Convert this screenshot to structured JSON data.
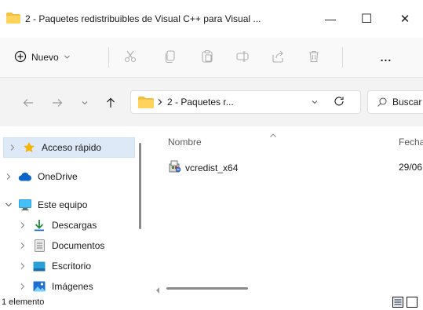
{
  "window": {
    "title": "2 - Paquetes redistribuibles de Visual C++ para Visual ...",
    "minimize": "—",
    "maximize": "☐",
    "close": "✕"
  },
  "toolbar": {
    "new_label": "Nuevo",
    "more": "..."
  },
  "address": {
    "path_label": "2 - Paquetes r...",
    "search_placeholder": "Buscar en"
  },
  "sidebar": {
    "items": [
      {
        "label": "Acceso rápido",
        "icon": "star-icon",
        "selected": true
      },
      {
        "label": "OneDrive",
        "icon": "cloud-icon"
      },
      {
        "label": "Este equipo",
        "icon": "monitor-icon",
        "expanded": true
      },
      {
        "label": "Descargas",
        "icon": "download-icon"
      },
      {
        "label": "Documentos",
        "icon": "document-icon"
      },
      {
        "label": "Escritorio",
        "icon": "desktop-icon"
      },
      {
        "label": "Imágenes",
        "icon": "image-icon"
      }
    ]
  },
  "content": {
    "columns": {
      "name": "Nombre",
      "date": "Fecha"
    },
    "files": [
      {
        "name": "vcredist_x64",
        "date": "29/06",
        "icon": "installer-icon"
      }
    ]
  },
  "status": {
    "text": "1 elemento"
  },
  "colors": {
    "accent": "#0067c0",
    "folder": "#f4c042",
    "selected_bg": "#dde9f7"
  }
}
